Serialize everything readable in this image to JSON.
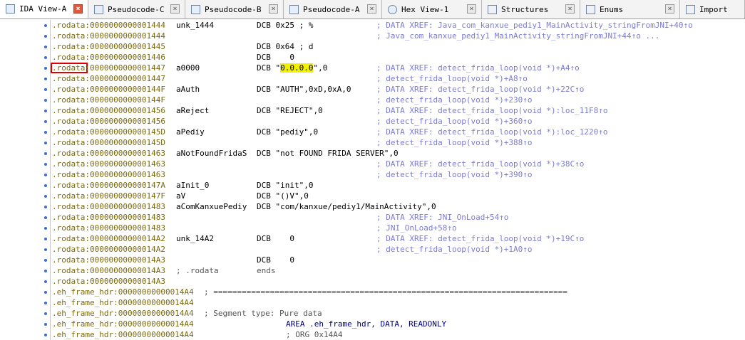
{
  "tabs": [
    {
      "label": "IDA View-A",
      "icon": "ida-view-icon",
      "active": true
    },
    {
      "label": "Pseudocode-C",
      "icon": "pseudocode-icon",
      "active": false
    },
    {
      "label": "Pseudocode-B",
      "icon": "pseudocode-icon",
      "active": false
    },
    {
      "label": "Pseudocode-A",
      "icon": "pseudocode-icon",
      "active": false
    },
    {
      "label": "Hex View-1",
      "icon": "hex-view-icon",
      "active": false
    },
    {
      "label": "Structures",
      "icon": "structures-icon",
      "active": false
    },
    {
      "label": "Enums",
      "icon": "enums-icon",
      "active": false
    },
    {
      "label": "Import",
      "icon": "imports-icon",
      "active": false
    }
  ],
  "close_glyph": "×",
  "highlight_color": "#f0f000",
  "accent_box_color": "#e00000",
  "lines": [
    {
      "addr": ".rodata:0000000000001444",
      "label": "unk_1444",
      "op": "DCB 0x25 ; %",
      "comment": "; DATA XREF: Java_com_kanxue_pediy1_MainActivity_stringFromJNI+40↑o"
    },
    {
      "addr": ".rodata:0000000000001444",
      "label": "",
      "op": "",
      "comment": "; Java_com_kanxue_pediy1_MainActivity_stringFromJNI+44↑o ..."
    },
    {
      "addr": ".rodata:0000000000001445",
      "label": "",
      "op": "DCB 0x64 ; d",
      "comment": ""
    },
    {
      "addr": ".rodata:0000000000001446",
      "label": "",
      "op": "DCB    0",
      "comment": ""
    },
    {
      "addr": ".rodata:0000000000001447",
      "label": "a0000",
      "op": "DCB \"0.0.0.0\",0",
      "comment": "; DATA XREF: detect_frida_loop(void *)+A4↑o"
    },
    {
      "addr": ".rodata:0000000000001447",
      "label": "",
      "op": "",
      "comment": "; detect_frida_loop(void *)+A8↑o"
    },
    {
      "addr": ".rodata:000000000000144F",
      "label": "aAuth",
      "op": "DCB \"AUTH\",0xD,0xA,0",
      "comment": "; DATA XREF: detect_frida_loop(void *)+22C↑o"
    },
    {
      "addr": ".rodata:000000000000144F",
      "label": "",
      "op": "",
      "comment": "; detect_frida_loop(void *)+230↑o"
    },
    {
      "addr": ".rodata:0000000000001456",
      "label": "aReject",
      "op": "DCB \"REJECT\",0",
      "comment": "; DATA XREF: detect_frida_loop(void *):loc_11F8↑o"
    },
    {
      "addr": ".rodata:0000000000001456",
      "label": "",
      "op": "",
      "comment": "; detect_frida_loop(void *)+360↑o"
    },
    {
      "addr": ".rodata:000000000000145D",
      "label": "aPediy",
      "op": "DCB \"pediy\",0",
      "comment": "; DATA XREF: detect_frida_loop(void *):loc_1220↑o"
    },
    {
      "addr": ".rodata:000000000000145D",
      "label": "",
      "op": "",
      "comment": "; detect_frida_loop(void *)+388↑o"
    },
    {
      "addr": ".rodata:0000000000001463",
      "label": "aNotFoundFridaS",
      "op": "DCB \"not FOUND FRIDA SERVER\",0",
      "comment": ""
    },
    {
      "addr": ".rodata:0000000000001463",
      "label": "",
      "op": "",
      "comment": "; DATA XREF: detect_frida_loop(void *)+38C↑o"
    },
    {
      "addr": ".rodata:0000000000001463",
      "label": "",
      "op": "",
      "comment": "; detect_frida_loop(void *)+390↑o"
    },
    {
      "addr": ".rodata:000000000000147A",
      "label": "aInit_0",
      "op": "DCB \"init\",0",
      "comment": ""
    },
    {
      "addr": ".rodata:000000000000147F",
      "label": "aV",
      "op": "DCB \"()V\",0",
      "comment": ""
    },
    {
      "addr": ".rodata:0000000000001483",
      "label": "aComKanxuePediy",
      "op": "DCB \"com/kanxue/pediy1/MainActivity\",0",
      "comment": ""
    },
    {
      "addr": ".rodata:0000000000001483",
      "label": "",
      "op": "",
      "comment": "; DATA XREF: JNI_OnLoad+54↑o"
    },
    {
      "addr": ".rodata:0000000000001483",
      "label": "",
      "op": "",
      "comment": "; JNI_OnLoad+58↑o"
    },
    {
      "addr": ".rodata:00000000000014A2",
      "label": "unk_14A2",
      "op": "DCB    0",
      "comment": "; DATA XREF: detect_frida_loop(void *)+19C↑o"
    },
    {
      "addr": ".rodata:00000000000014A2",
      "label": "",
      "op": "",
      "comment": "; detect_frida_loop(void *)+1A0↑o"
    },
    {
      "addr": ".rodata:00000000000014A3",
      "label": "",
      "op": "DCB    0",
      "comment": ""
    },
    {
      "addr": ".rodata:00000000000014A3",
      "label": "; .rodata",
      "op": "ends",
      "comment": ""
    },
    {
      "addr": ".rodata:00000000000014A3",
      "label": "",
      "op": "",
      "comment": ""
    },
    {
      "addr": ".eh_frame_hdr:00000000000014A4",
      "label": "",
      "op": "",
      "comment": "; ==========================================================================="
    },
    {
      "addr": ".eh_frame_hdr:00000000000014A4",
      "label": "",
      "op": "",
      "comment": ""
    },
    {
      "addr": ".eh_frame_hdr:00000000000014A4",
      "label": "",
      "op": "",
      "comment": "; Segment type: Pure data"
    },
    {
      "addr": ".eh_frame_hdr:00000000000014A4",
      "label": "",
      "op": "",
      "comment": "AREA .eh_frame_hdr, DATA, READONLY"
    },
    {
      "addr": ".eh_frame_hdr:00000000000014A4",
      "label": "",
      "op": "",
      "comment": "; ORG 0x14A4"
    }
  ]
}
